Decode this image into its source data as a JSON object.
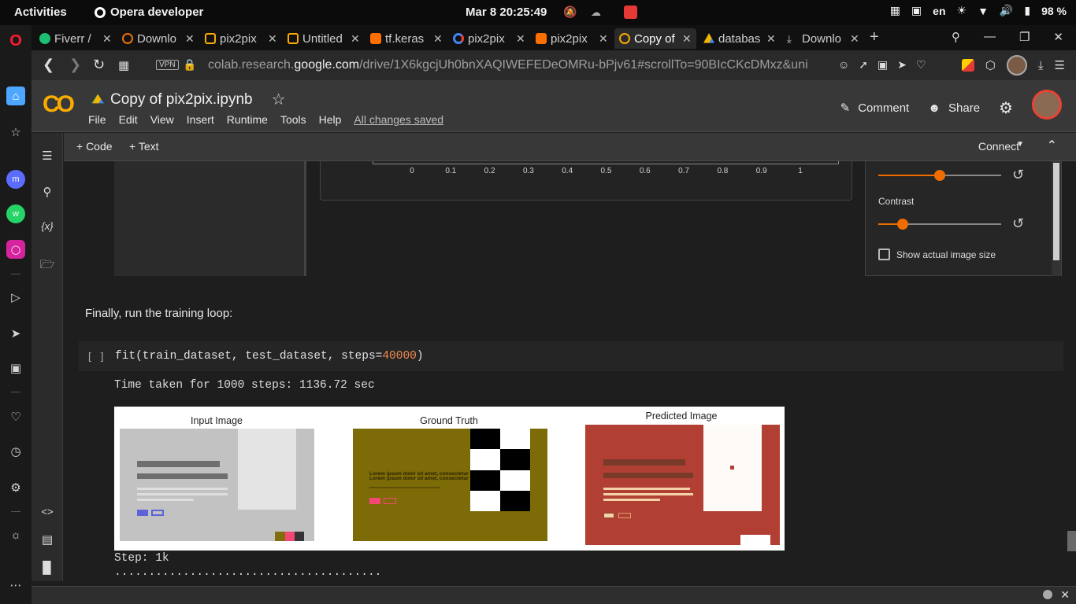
{
  "system": {
    "activities": "Activities",
    "app_name": "Opera developer",
    "clock": "Mar 8  20:25:49",
    "language": "en",
    "battery": "98 %"
  },
  "tabs": [
    {
      "label": "Fiverr /",
      "favicon_color": "#1dbf73"
    },
    {
      "label": "Downlo",
      "favicon_color": "#e8710a"
    },
    {
      "label": "pix2pix",
      "favicon_color": "#f9ab00"
    },
    {
      "label": "Untitled",
      "favicon_color": "#f9ab00"
    },
    {
      "label": "tf.keras",
      "favicon_color": "#ff6f00"
    },
    {
      "label": "pix2pix",
      "favicon_color": "#4285f4"
    },
    {
      "label": "pix2pix",
      "favicon_color": "#ff6f00"
    },
    {
      "label": "Copy of",
      "favicon_color": "#f9ab00"
    },
    {
      "label": "databas",
      "favicon_color": "#0f9d58"
    },
    {
      "label": "Downlo",
      "favicon_color": "#cccccc"
    }
  ],
  "address": {
    "vpn": "VPN",
    "url_prefix": "colab.research.",
    "url_host": "google.com",
    "url_path": "/drive/1X6kgcjUh0bnXAQIWEFEDeOMRu-bPjv61#scrollTo=90BIcCKcDMxz&uni"
  },
  "colab": {
    "title": "Copy of pix2pix.ipynb",
    "menu": [
      "File",
      "Edit",
      "View",
      "Insert",
      "Runtime",
      "Tools",
      "Help"
    ],
    "saved": "All changes saved",
    "comment": "Comment",
    "share": "Share",
    "add_code": "+ Code",
    "add_text": "+ Text",
    "connect": "Connect"
  },
  "plot": {
    "ticks": [
      "0",
      "0.1",
      "0.2",
      "0.3",
      "0.4",
      "0.5",
      "0.6",
      "0.7",
      "0.8",
      "0.9",
      "1"
    ]
  },
  "image_settings": {
    "brightness_value": 0.5,
    "contrast_label": "Contrast",
    "contrast_value": 0.2,
    "actual_size_label": "Show actual image size",
    "actual_size_checked": false
  },
  "cells": {
    "markdown": "Finally, run the training loop:",
    "run_indicator": "[ ]",
    "code_prefix": "fit(train_dataset, test_dataset, steps=",
    "code_number": "40000",
    "code_suffix": ")",
    "time_taken": "Time taken for 1000 steps: 1136.72 sec",
    "step": "Step: 1k",
    "progress_dots": "......................................."
  },
  "figure": {
    "panels": [
      "Input Image",
      "Ground Truth",
      "Predicted Image"
    ],
    "lorem_line": "Lorem ipsum dolor sit amet, consectetur"
  }
}
